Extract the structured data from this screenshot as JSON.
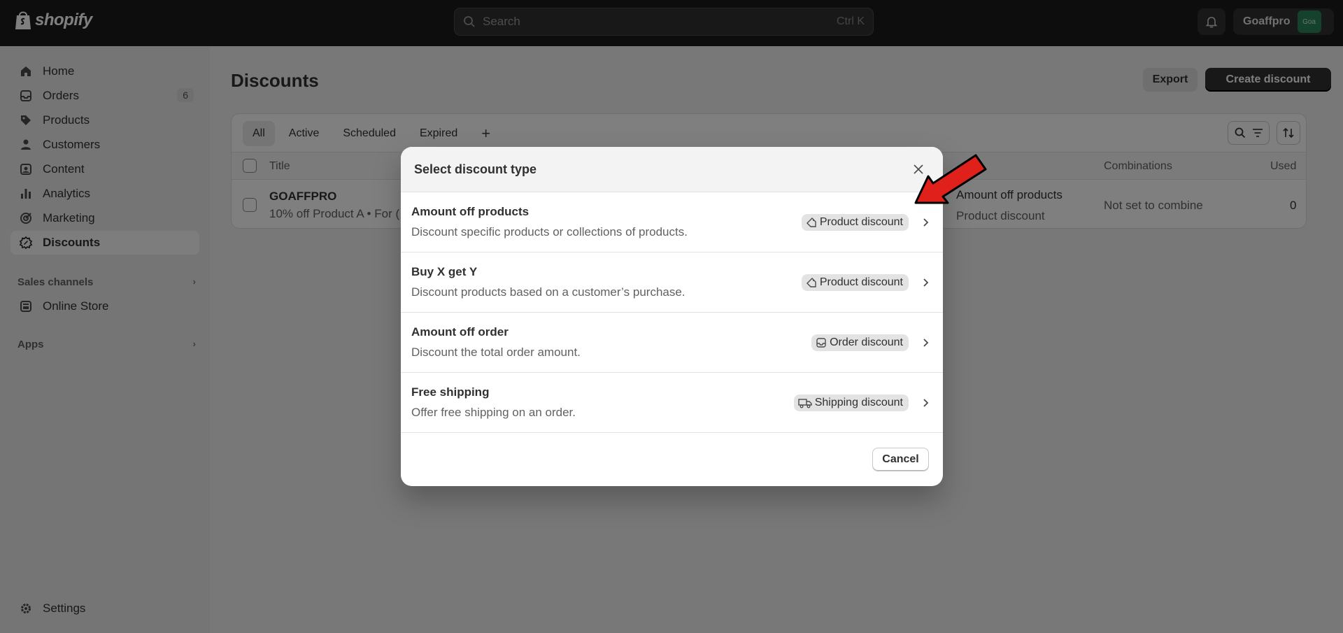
{
  "topbar": {
    "logo_text": "shopify",
    "search_placeholder": "Search",
    "search_shortcut": "Ctrl K",
    "store_name": "Goaffpro",
    "store_avatar_text": "Goa"
  },
  "sidebar": {
    "items": [
      {
        "label": "Home",
        "icon": "home-icon"
      },
      {
        "label": "Orders",
        "icon": "orders-icon",
        "count": "6"
      },
      {
        "label": "Products",
        "icon": "tag-icon"
      },
      {
        "label": "Customers",
        "icon": "person-icon"
      },
      {
        "label": "Content",
        "icon": "content-icon"
      },
      {
        "label": "Analytics",
        "icon": "bar-chart-icon"
      },
      {
        "label": "Marketing",
        "icon": "target-icon"
      },
      {
        "label": "Discounts",
        "icon": "discount-icon",
        "active": true
      }
    ],
    "sales_channels_label": "Sales channels",
    "online_store_label": "Online Store",
    "apps_label": "Apps",
    "settings_label": "Settings"
  },
  "page": {
    "title": "Discounts",
    "export_label": "Export",
    "create_label": "Create discount",
    "tabs": [
      "All",
      "Active",
      "Scheduled",
      "Expired"
    ],
    "add_tab": "+",
    "columns": {
      "title": "Title",
      "combinations": "Combinations",
      "used": "Used"
    },
    "row": {
      "title": "GOAFFPRO",
      "subtitle": "10% off Product A • For (",
      "method_line1": "Amount off products",
      "method_line2": "Product discount",
      "combinations": "Not set to combine",
      "used": "0"
    }
  },
  "modal": {
    "title": "Select discount type",
    "options": [
      {
        "title": "Amount off products",
        "description": "Discount specific products or collections of products.",
        "badge": "Product discount",
        "badge_icon": "tag-icon"
      },
      {
        "title": "Buy X get Y",
        "description": "Discount products based on a customer’s purchase.",
        "badge": "Product discount",
        "badge_icon": "tag-icon"
      },
      {
        "title": "Amount off order",
        "description": "Discount the total order amount.",
        "badge": "Order discount",
        "badge_icon": "inbox-icon"
      },
      {
        "title": "Free shipping",
        "description": "Offer free shipping on an order.",
        "badge": "Shipping discount",
        "badge_icon": "truck-icon"
      }
    ],
    "cancel_label": "Cancel"
  },
  "colors": {
    "topbar": "#1a1a1a",
    "accent_avatar": "#29845a",
    "annotation_arrow": "#e0201b"
  }
}
